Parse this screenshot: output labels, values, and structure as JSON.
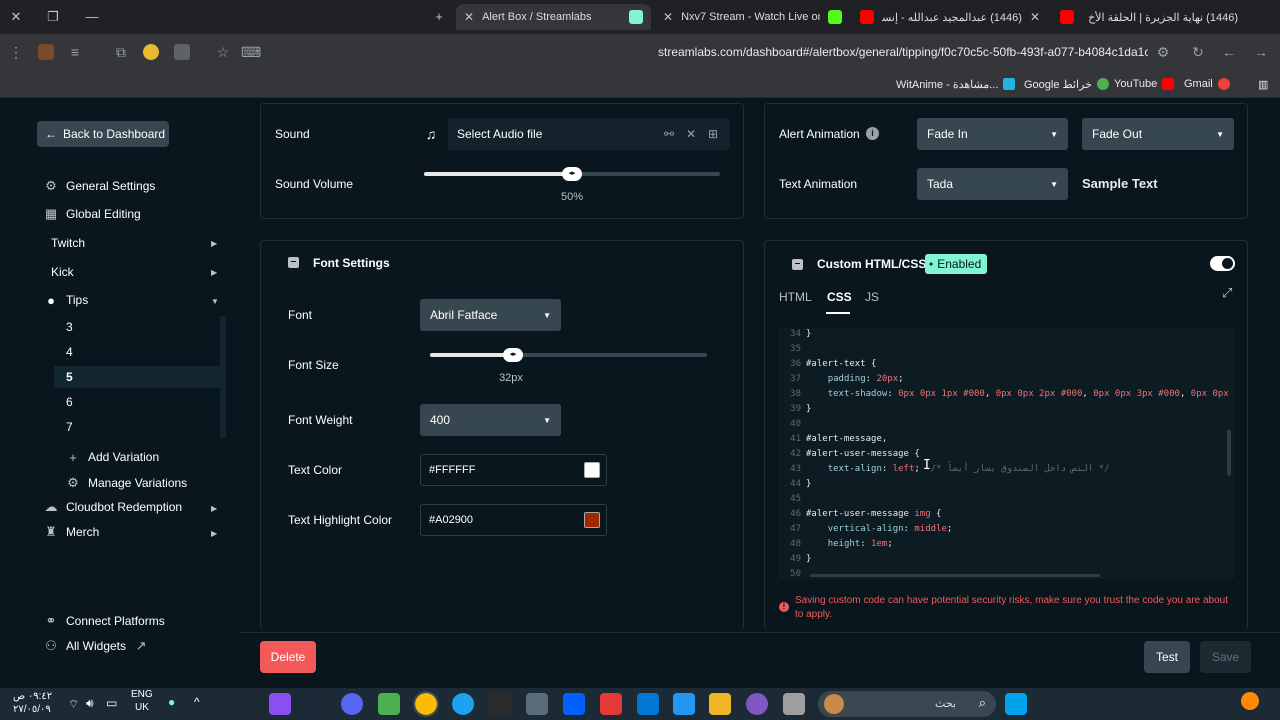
{
  "browser": {
    "tabs": [
      {
        "label": "Alert Box / Streamlabs",
        "active": true,
        "color": "#80f5d2"
      },
      {
        "label": "Nxv7 Stream - Watch Live on Ki",
        "active": false,
        "color": "#53fc18"
      },
      {
        "label": "(1446) عبدالمجيد عبدالله - إنسان",
        "active": false,
        "color": "#ff0000"
      },
      {
        "label": "(1446) نهاية الجزيرة | الحلقة الأخ",
        "active": false,
        "color": "#ff0000"
      }
    ],
    "url": "streamlabs.com/dashboard#/alertbox/general/tipping/f0c70c5c-50fb-493f-a077-b4084c1da1cf",
    "bookmarks": [
      {
        "label": "WitAnime - مشاهدة...",
        "color": "#1fb6e0"
      },
      {
        "label": "Google خرائط",
        "color": "#4caf50"
      },
      {
        "label": "YouTube",
        "color": "#ff0000"
      },
      {
        "label": "Gmail",
        "color": "#ea4335"
      }
    ]
  },
  "sidebar": {
    "back_label": "Back to Dashboard",
    "general_settings": "General Settings",
    "global_editing": "Global Editing",
    "twitch": "Twitch",
    "kick": "Kick",
    "tips": "Tips",
    "variations": [
      "3",
      "4",
      "5",
      "6",
      "7"
    ],
    "add_variation": "Add Variation",
    "manage_variations": "Manage Variations",
    "cloudbot": "Cloudbot Redemption",
    "merch": "Merch",
    "connect_platforms": "Connect Platforms",
    "all_widgets": "All Widgets"
  },
  "sound_panel": {
    "sound_label": "Sound",
    "audio_placeholder": "Select Audio file",
    "volume_label": "Sound Volume",
    "volume_value": "50%",
    "volume_fraction": 0.5
  },
  "animation_panel": {
    "alert_animation_label": "Alert Animation",
    "alert_in": "Fade In",
    "alert_out": "Fade Out",
    "text_animation_label": "Text Animation",
    "text_animation": "Tada",
    "sample_text": "Sample Text"
  },
  "font_panel": {
    "title": "Font Settings",
    "font_label": "Font",
    "font_value": "Abril Fatface",
    "size_label": "Font Size",
    "size_value": "32px",
    "size_fraction": 0.3,
    "weight_label": "Font Weight",
    "weight_value": "400",
    "color_label": "Text Color",
    "color_value": "#FFFFFF",
    "highlight_label": "Text Highlight Color",
    "highlight_value": "#A02900"
  },
  "custom_panel": {
    "title": "Custom HTML/CSS",
    "badge": "Enabled",
    "tabs": [
      "HTML",
      "CSS",
      "JS"
    ],
    "active_tab": "CSS",
    "code": [
      {
        "n": "34",
        "parts": [
          [
            "pun",
            "}"
          ]
        ]
      },
      {
        "n": "35",
        "parts": []
      },
      {
        "n": "36",
        "parts": [
          [
            "sel",
            "#alert-text"
          ],
          [
            "pun",
            " {"
          ]
        ]
      },
      {
        "n": "37",
        "parts": [
          [
            "pun",
            "    "
          ],
          [
            "prop",
            "padding"
          ],
          [
            "pun",
            ": "
          ],
          [
            "val",
            "20px"
          ],
          [
            "pun",
            ";"
          ]
        ]
      },
      {
        "n": "38",
        "parts": [
          [
            "pun",
            "    "
          ],
          [
            "prop",
            "text-shadow"
          ],
          [
            "pun",
            ": "
          ],
          [
            "val",
            "0px 0px 1px #000"
          ],
          [
            "pun",
            ", "
          ],
          [
            "val",
            "0px 0px 2px #000"
          ],
          [
            "pun",
            ", "
          ],
          [
            "val",
            "0px 0px 3px #000"
          ],
          [
            "pun",
            ", "
          ],
          [
            "val",
            "0px 0px"
          ]
        ]
      },
      {
        "n": "39",
        "parts": [
          [
            "pun",
            "}"
          ]
        ]
      },
      {
        "n": "40",
        "parts": []
      },
      {
        "n": "41",
        "parts": [
          [
            "sel",
            "#alert-message"
          ],
          [
            "pun",
            ","
          ]
        ]
      },
      {
        "n": "42",
        "parts": [
          [
            "sel",
            "#alert-user-message"
          ],
          [
            "pun",
            " {"
          ]
        ]
      },
      {
        "n": "43",
        "parts": [
          [
            "pun",
            "    "
          ],
          [
            "prop",
            "text-align"
          ],
          [
            "pun",
            ": "
          ],
          [
            "val",
            "left"
          ],
          [
            "pun",
            ";  "
          ],
          [
            "com",
            "/* النص داخل الصندوق يسار أيضاً */"
          ]
        ]
      },
      {
        "n": "44",
        "parts": [
          [
            "pun",
            "}"
          ]
        ]
      },
      {
        "n": "45",
        "parts": []
      },
      {
        "n": "46",
        "parts": [
          [
            "sel",
            "#alert-user-message"
          ],
          [
            "pun",
            " "
          ],
          [
            "val",
            "img"
          ],
          [
            "pun",
            " {"
          ]
        ]
      },
      {
        "n": "47",
        "parts": [
          [
            "pun",
            "    "
          ],
          [
            "prop",
            "vertical-align"
          ],
          [
            "pun",
            ": "
          ],
          [
            "val",
            "middle"
          ],
          [
            "pun",
            ";"
          ]
        ]
      },
      {
        "n": "48",
        "parts": [
          [
            "pun",
            "    "
          ],
          [
            "prop",
            "height"
          ],
          [
            "pun",
            ": "
          ],
          [
            "val",
            "1em"
          ],
          [
            "pun",
            ";"
          ]
        ]
      },
      {
        "n": "49",
        "parts": [
          [
            "pun",
            "}"
          ]
        ]
      },
      {
        "n": "50",
        "parts": []
      }
    ],
    "warning": "Saving custom code can have potential security risks, make sure you trust the code you are about to apply."
  },
  "footer": {
    "delete_label": "Delete",
    "test_label": "Test",
    "save_label": "Save"
  },
  "taskbar": {
    "lang_top": "ENG",
    "lang_bottom": "UK",
    "time": "٠٩:٤٢ ص",
    "date": "٢٧/٠٥/٠٩",
    "search_placeholder": "بحث"
  },
  "colors": {
    "accent": "#80f5d2",
    "delete": "#f25a5a",
    "highlight": "#A02900"
  }
}
